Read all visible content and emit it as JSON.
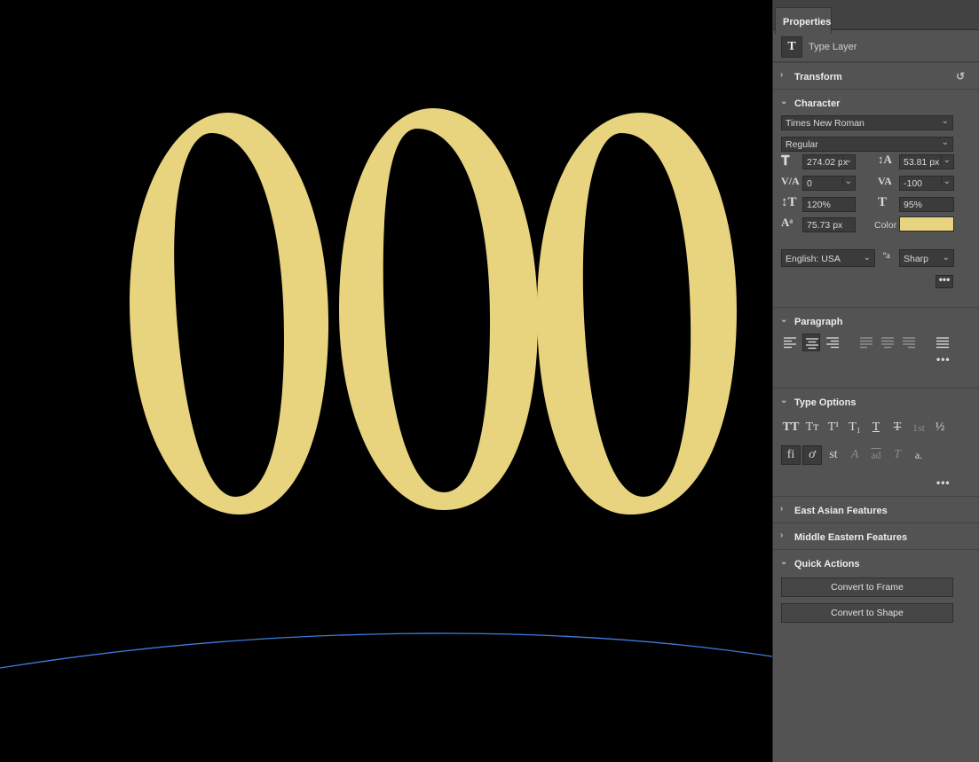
{
  "canvas": {
    "text": "000",
    "text_color": "#E8D47E",
    "background": "#000000",
    "path_color": "#3F7BE0"
  },
  "panel": {
    "tab": "Properties",
    "layer_type_icon": "T",
    "layer_type": "Type Layer",
    "sections": {
      "transform": "Transform",
      "character": "Character",
      "paragraph": "Paragraph",
      "type_options": "Type Options",
      "east_asian": "East Asian Features",
      "middle_eastern": "Middle Eastern Features",
      "quick_actions": "Quick Actions"
    },
    "character": {
      "font_family": "Times New Roman",
      "font_style": "Regular",
      "font_size": "274.02 px",
      "leading": "53.81 px",
      "kerning": "0",
      "tracking": "-100",
      "vertical_scale": "120%",
      "horizontal_scale": "95%",
      "baseline_shift": "75.73 px",
      "color_label": "Color",
      "color_value": "#E8D47E",
      "language": "English: USA",
      "antialias": "Sharp",
      "more": "•••"
    },
    "paragraph": {
      "alignments": [
        "align-left",
        "align-center",
        "align-right",
        "justify-last-left",
        "justify-last-center",
        "justify-last-right",
        "justify-all"
      ],
      "active_alignment": "align-center",
      "more": "•••"
    },
    "type_options": {
      "row1": [
        "TT",
        "Tт",
        "T¹",
        "T₁",
        "T",
        "T",
        "1st",
        "½"
      ],
      "row2": [
        "fi",
        "ơ",
        "st",
        "A",
        "ad",
        "T",
        "a."
      ],
      "more": "•••"
    },
    "quick_actions": {
      "convert_frame": "Convert to Frame",
      "convert_shape": "Convert to Shape"
    }
  }
}
